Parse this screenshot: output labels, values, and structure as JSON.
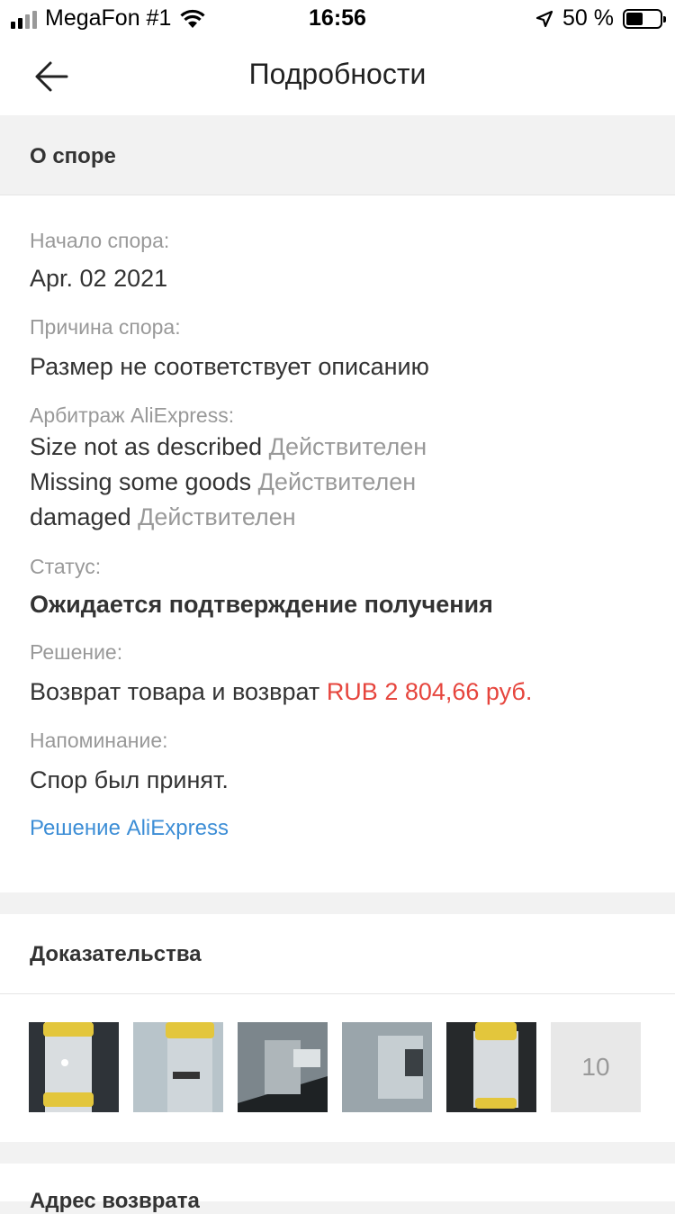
{
  "status_bar": {
    "carrier": "MegaFon #1",
    "time": "16:56",
    "battery_text": "50 %",
    "battery_level": 0.5
  },
  "nav": {
    "title": "Подробности"
  },
  "dispute": {
    "section_title": "О споре",
    "start_label": "Начало спора:",
    "start_value": "Apr. 02 2021",
    "reason_label": "Причина спора:",
    "reason_value": "Размер не соответствует описанию",
    "arbitration_label": "Арбитраж AliExpress:",
    "arbitration_items": [
      {
        "text": "Size not as described",
        "status": "Действителен"
      },
      {
        "text": "Missing some goods",
        "status": "Действителен"
      },
      {
        "text": "damaged",
        "status": "Действителен"
      }
    ],
    "status_label": "Статус:",
    "status_value": "Ожидается подтверждение получения",
    "solution_label": "Решение:",
    "solution_text": "Возврат товара и возврат",
    "solution_amount": "RUB 2 804,66 руб.",
    "reminder_label": "Напоминание:",
    "reminder_value": "Спор был принят.",
    "ali_link": "Решение AliExpress"
  },
  "evidence": {
    "section_title": "Доказательства",
    "more_count": "10"
  },
  "return_address": {
    "section_title": "Адрес возврата"
  },
  "colors": {
    "accent_link": "#3d8ed6",
    "price": "#e6453d"
  }
}
